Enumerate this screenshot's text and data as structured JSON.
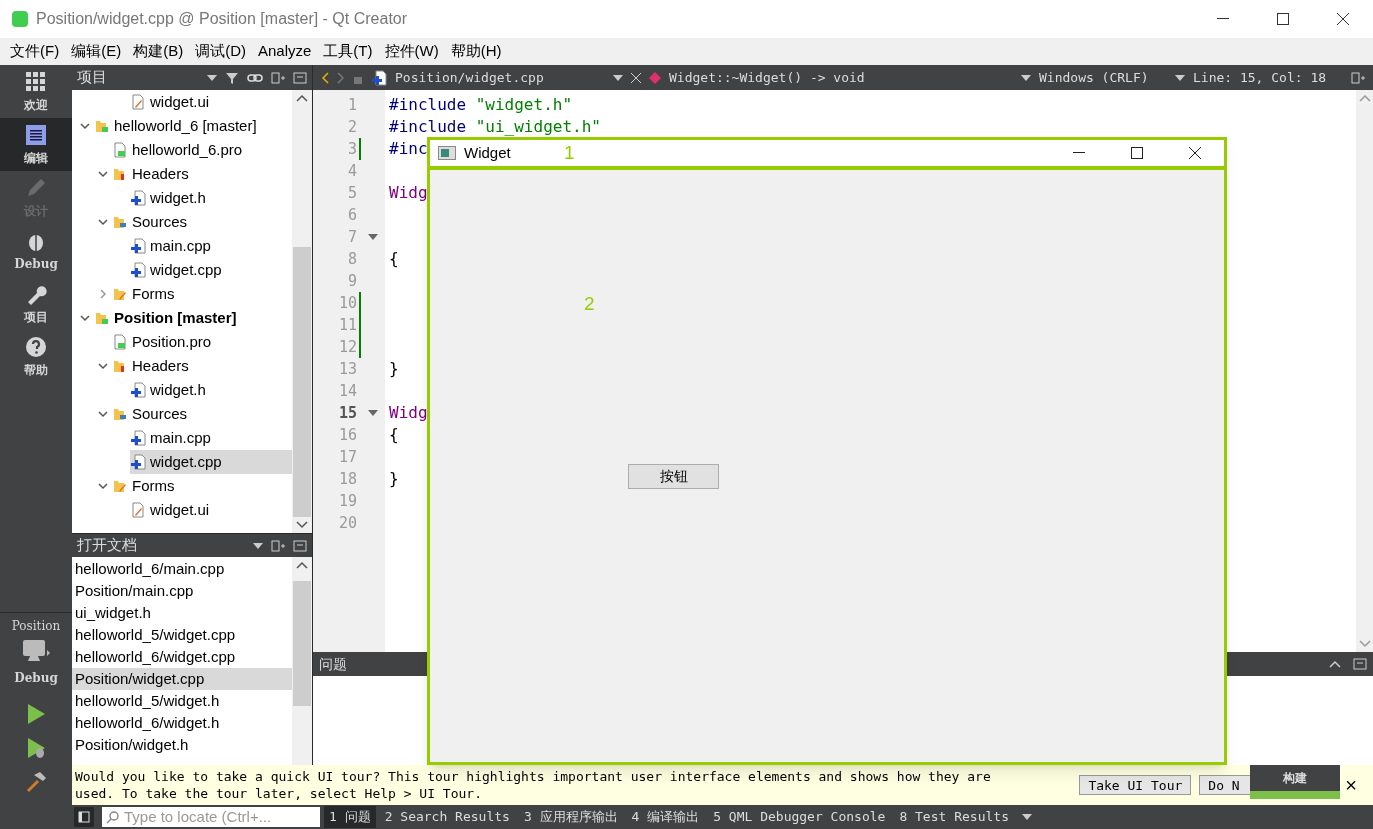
{
  "window": {
    "title": "Position/widget.cpp @ Position [master] - Qt Creator"
  },
  "menu": [
    "文件(F)",
    "编辑(E)",
    "构建(B)",
    "调试(D)",
    "Analyze",
    "工具(T)",
    "控件(W)",
    "帮助(H)"
  ],
  "modes": [
    {
      "label": "欢迎",
      "kind": "welcome",
      "selected": false,
      "disabled": false
    },
    {
      "label": "编辑",
      "kind": "edit",
      "selected": true,
      "disabled": false
    },
    {
      "label": "设计",
      "kind": "design",
      "selected": false,
      "disabled": true
    },
    {
      "label": "Debug",
      "kind": "debug",
      "selected": false,
      "disabled": false
    },
    {
      "label": "项目",
      "kind": "projects",
      "selected": false,
      "disabled": false
    },
    {
      "label": "帮助",
      "kind": "help",
      "selected": false,
      "disabled": false
    }
  ],
  "target": {
    "project": "Position",
    "config": "Debug"
  },
  "projects_panel": {
    "title": "项目",
    "tree": [
      {
        "children": [
          {
            "children": [
              {
                "label": "widget.ui",
                "kind": "ui",
                "selected": false,
                "bold": false
              }
            ]
          }
        ]
      },
      {
        "label": "helloworld_6 [master]",
        "kind": "project",
        "expanded": true,
        "selected": false,
        "bold": false,
        "children": [
          {
            "label": "helloworld_6.pro",
            "kind": "pro",
            "selected": false,
            "bold": false
          },
          {
            "label": "Headers",
            "kind": "headers",
            "expanded": true,
            "selected": false,
            "bold": false,
            "children": [
              {
                "label": "widget.h",
                "kind": "h",
                "selected": false,
                "bold": false
              }
            ]
          },
          {
            "label": "Sources",
            "kind": "sources",
            "expanded": true,
            "selected": false,
            "bold": false,
            "children": [
              {
                "label": "main.cpp",
                "kind": "cpp",
                "selected": false,
                "bold": false
              },
              {
                "label": "widget.cpp",
                "kind": "cpp",
                "selected": false,
                "bold": false
              }
            ]
          },
          {
            "label": "Forms",
            "kind": "forms",
            "expanded": false,
            "selected": false,
            "bold": false
          }
        ]
      },
      {
        "label": "Position [master]",
        "kind": "project",
        "expanded": true,
        "selected": false,
        "bold": true,
        "children": [
          {
            "label": "Position.pro",
            "kind": "pro",
            "selected": false,
            "bold": false
          },
          {
            "label": "Headers",
            "kind": "headers",
            "expanded": true,
            "selected": false,
            "bold": false,
            "children": [
              {
                "label": "widget.h",
                "kind": "h",
                "selected": false,
                "bold": false
              }
            ]
          },
          {
            "label": "Sources",
            "kind": "sources",
            "expanded": true,
            "selected": false,
            "bold": false,
            "children": [
              {
                "label": "main.cpp",
                "kind": "cpp",
                "selected": false,
                "bold": false
              },
              {
                "label": "widget.cpp",
                "kind": "cpp",
                "selected": true,
                "bold": false
              }
            ]
          },
          {
            "label": "Forms",
            "kind": "forms",
            "expanded": true,
            "selected": false,
            "bold": false,
            "children": [
              {
                "label": "widget.ui",
                "kind": "ui",
                "selected": false,
                "bold": false
              }
            ]
          }
        ]
      }
    ]
  },
  "open_documents": {
    "title": "打开文档",
    "items": [
      {
        "label": "helloworld_6/main.cpp",
        "selected": false
      },
      {
        "label": "Position/main.cpp",
        "selected": false
      },
      {
        "label": "ui_widget.h",
        "selected": false
      },
      {
        "label": "helloworld_5/widget.cpp",
        "selected": false
      },
      {
        "label": "helloworld_6/widget.cpp",
        "selected": false
      },
      {
        "label": "Position/widget.cpp",
        "selected": true
      },
      {
        "label": "helloworld_5/widget.h",
        "selected": false
      },
      {
        "label": "helloworld_6/widget.h",
        "selected": false
      },
      {
        "label": "Position/widget.h",
        "selected": false
      }
    ]
  },
  "editor_toolbar": {
    "file": "Position/widget.cpp",
    "symbol": "Widget::~Widget() -> void",
    "line_endings": "Windows (CRLF)",
    "position": "Line: 15, Col: 18"
  },
  "code": [
    {
      "number": "1",
      "modified": false,
      "foldable": false,
      "current": false,
      "tokens": [
        {
          "text": "#include ",
          "kind": "preproc"
        },
        {
          "text": "\"widget.h\"",
          "kind": "string"
        }
      ]
    },
    {
      "number": "2",
      "modified": false,
      "foldable": false,
      "current": false,
      "tokens": [
        {
          "text": "#include ",
          "kind": "preproc"
        },
        {
          "text": "\"ui_widget.h\"",
          "kind": "string"
        }
      ]
    },
    {
      "number": "3",
      "modified": true,
      "foldable": false,
      "current": false,
      "tokens": [
        {
          "text": "#inc",
          "kind": "preproc"
        }
      ]
    },
    {
      "number": "4",
      "modified": false,
      "foldable": false,
      "current": false
    },
    {
      "number": "5",
      "modified": false,
      "foldable": false,
      "current": false,
      "tokens": [
        {
          "text": "Widg",
          "kind": "type"
        }
      ]
    },
    {
      "number": "6",
      "modified": false,
      "foldable": false,
      "current": false
    },
    {
      "number": "7",
      "modified": false,
      "foldable": true,
      "current": false
    },
    {
      "number": "8",
      "modified": false,
      "foldable": false,
      "current": false,
      "tokens": [
        {
          "text": "{",
          "kind": "plain"
        }
      ]
    },
    {
      "number": "9",
      "modified": false,
      "foldable": false,
      "current": false
    },
    {
      "number": "10",
      "modified": true,
      "foldable": false,
      "current": false
    },
    {
      "number": "11",
      "modified": true,
      "foldable": false,
      "current": false
    },
    {
      "number": "12",
      "modified": true,
      "foldable": false,
      "current": false
    },
    {
      "number": "13",
      "modified": false,
      "foldable": false,
      "current": false,
      "tokens": [
        {
          "text": "}",
          "kind": "plain"
        }
      ]
    },
    {
      "number": "14",
      "modified": false,
      "foldable": false,
      "current": false
    },
    {
      "number": "15",
      "modified": false,
      "foldable": true,
      "current": true,
      "tokens": [
        {
          "text": "Widg",
          "kind": "type"
        }
      ]
    },
    {
      "number": "16",
      "modified": false,
      "foldable": false,
      "current": false,
      "tokens": [
        {
          "text": "{",
          "kind": "plain"
        }
      ]
    },
    {
      "number": "17",
      "modified": false,
      "foldable": false,
      "current": false
    },
    {
      "number": "18",
      "modified": false,
      "foldable": false,
      "current": false,
      "tokens": [
        {
          "text": "}",
          "kind": "plain"
        }
      ]
    },
    {
      "number": "19",
      "modified": false,
      "foldable": false,
      "current": false
    },
    {
      "number": "20",
      "modified": false,
      "foldable": false,
      "current": false
    }
  ],
  "issues_panel": {
    "title": "问题"
  },
  "widget_window": {
    "title": "Widget",
    "label_1": "1",
    "label_2": "2",
    "button": "按钮"
  },
  "tour_bar": {
    "message": "Would you like to take a quick UI tour? This tour highlights important user interface elements and shows how they are used. To take the tour later, select Help > UI Tour.",
    "take_button": "Take UI Tour",
    "skip_button": "Do N",
    "close": "×"
  },
  "build_tooltip": {
    "label": "构建"
  },
  "bottom_bar": {
    "locator_placeholder": "Type to locate (Ctrl+...",
    "tabs": [
      {
        "label": "1 问题",
        "selected": true
      },
      {
        "label": "2 Search Results",
        "selected": false
      },
      {
        "label": "3 应用程序输出",
        "selected": false
      },
      {
        "label": "4 编译输出",
        "selected": false
      },
      {
        "label": "5 QML Debugger Console",
        "selected": false
      },
      {
        "label": "8 Test Results",
        "selected": false
      }
    ]
  }
}
